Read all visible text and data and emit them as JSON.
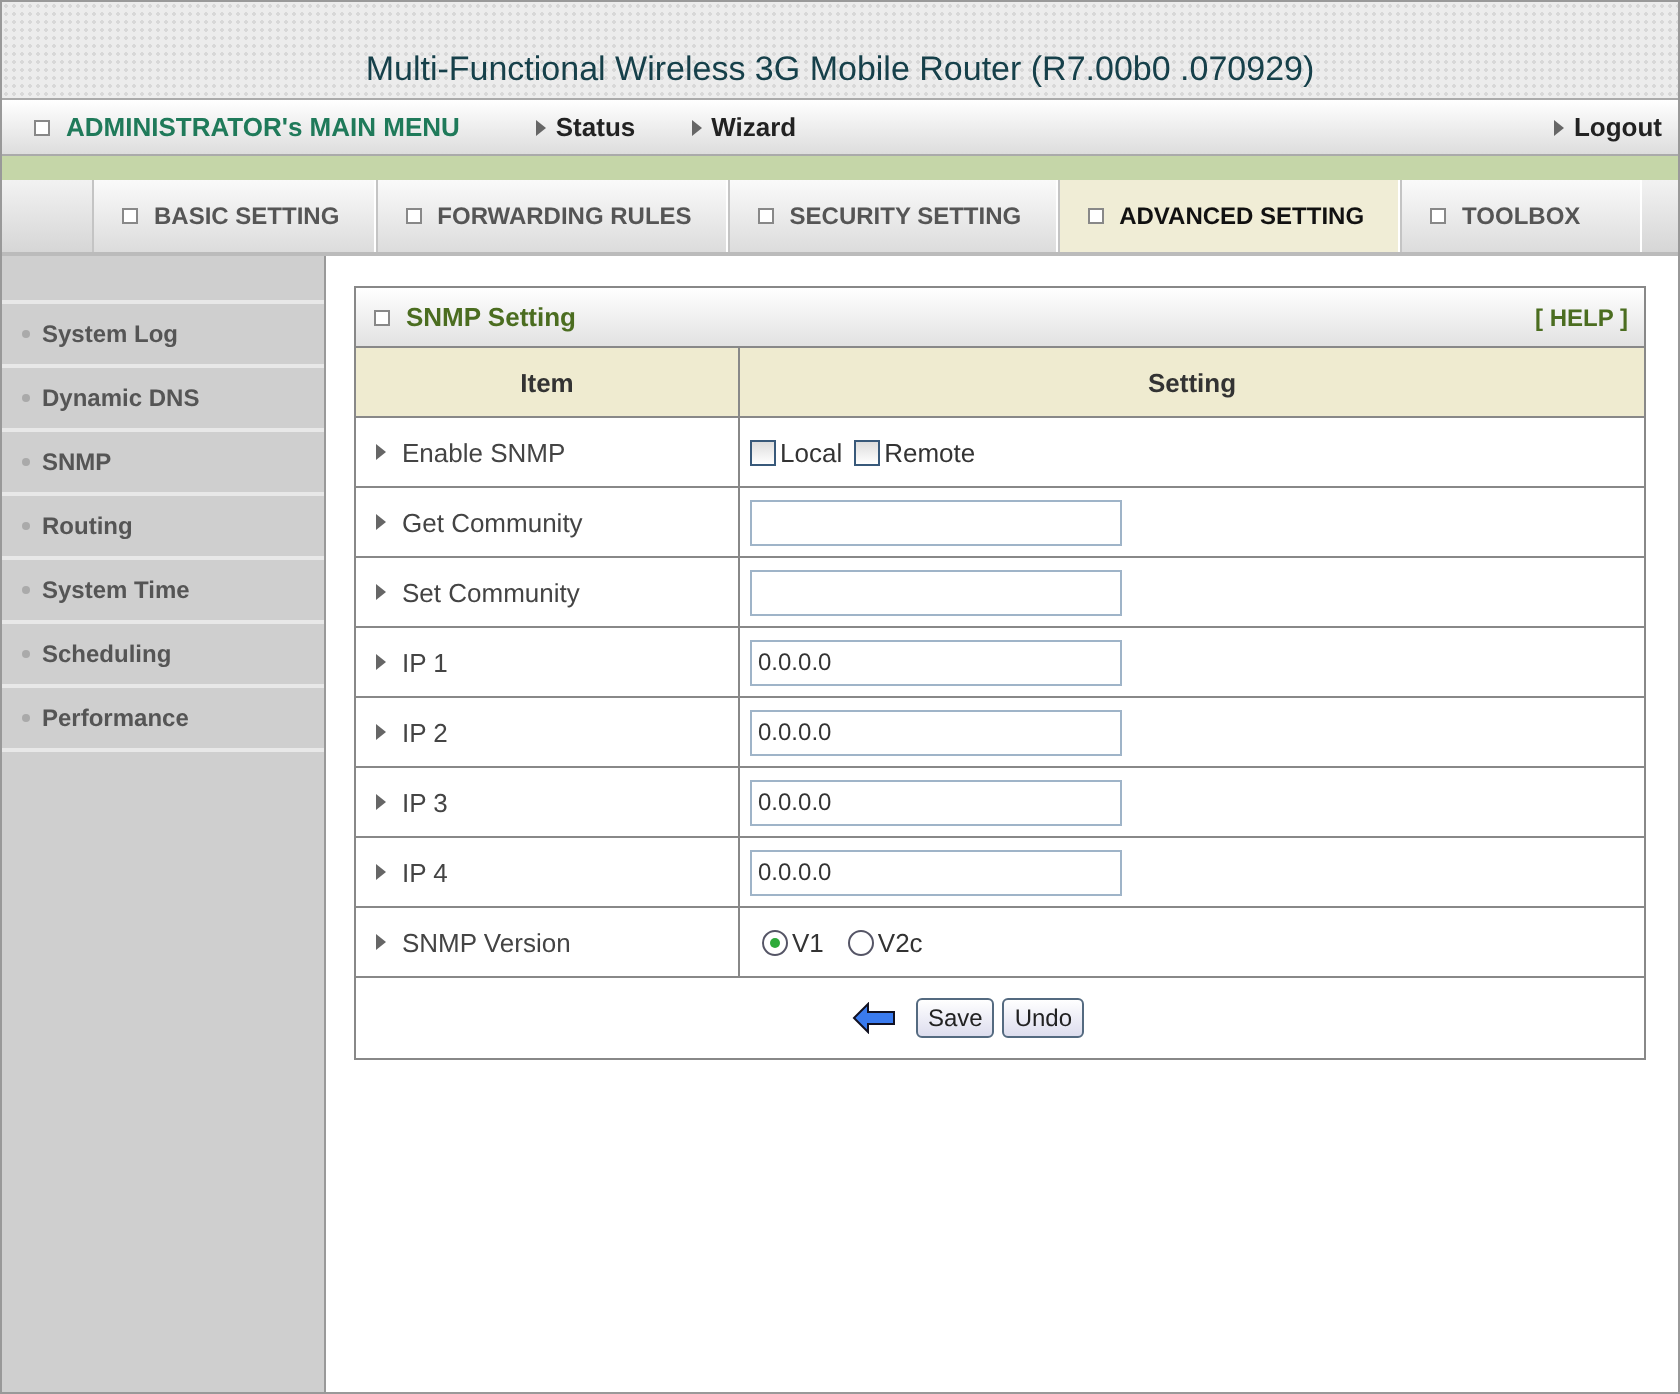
{
  "header": {
    "title": "Multi-Functional Wireless 3G Mobile Router (R7.00b0 .070929)"
  },
  "menu": {
    "title": "ADMINISTRATOR's MAIN MENU",
    "links": [
      "Status",
      "Wizard"
    ],
    "logout": "Logout"
  },
  "tabs": [
    {
      "label": "BASIC SETTING",
      "selected": false
    },
    {
      "label": "FORWARDING RULES",
      "selected": false
    },
    {
      "label": "SECURITY SETTING",
      "selected": false
    },
    {
      "label": "ADVANCED SETTING",
      "selected": true
    },
    {
      "label": "TOOLBOX",
      "selected": false
    }
  ],
  "sidebar": {
    "items": [
      "System Log",
      "Dynamic DNS",
      "SNMP",
      "Routing",
      "System Time",
      "Scheduling",
      "Performance"
    ]
  },
  "panel": {
    "title": "SNMP Setting",
    "help": "[ HELP ]",
    "columns": [
      "Item",
      "Setting"
    ],
    "rows": [
      {
        "label": "Enable SNMP",
        "kind": "checkboxes",
        "options": [
          {
            "label": "Local",
            "checked": false
          },
          {
            "label": "Remote",
            "checked": false
          }
        ]
      },
      {
        "label": "Get Community",
        "kind": "text",
        "value": ""
      },
      {
        "label": "Set Community",
        "kind": "text",
        "value": ""
      },
      {
        "label": "IP 1",
        "kind": "text",
        "value": "0.0.0.0"
      },
      {
        "label": "IP 2",
        "kind": "text",
        "value": "0.0.0.0"
      },
      {
        "label": "IP 3",
        "kind": "text",
        "value": "0.0.0.0"
      },
      {
        "label": "IP 4",
        "kind": "text",
        "value": "0.0.0.0"
      },
      {
        "label": "SNMP Version",
        "kind": "radios",
        "options": [
          {
            "label": "V1",
            "selected": true
          },
          {
            "label": "V2c",
            "selected": false
          }
        ]
      }
    ],
    "buttons": [
      "Save",
      "Undo"
    ]
  }
}
